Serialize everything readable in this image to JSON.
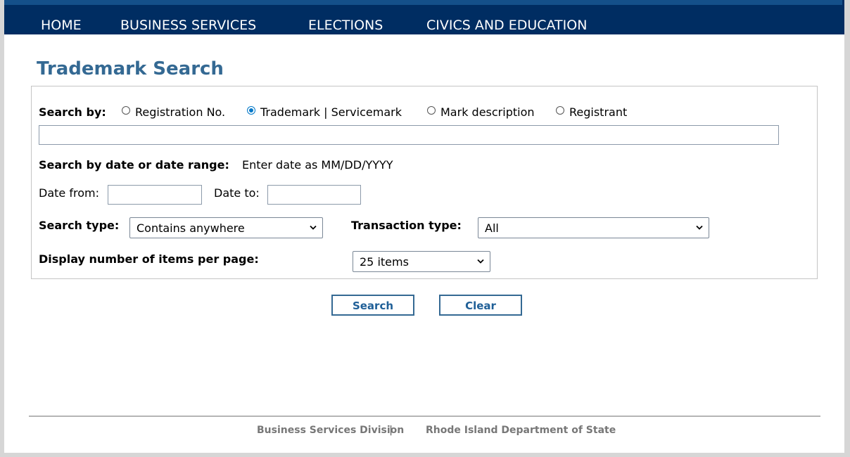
{
  "nav": {
    "items": [
      {
        "label": "HOME"
      },
      {
        "label": "BUSINESS SERVICES"
      },
      {
        "label": "ELECTIONS"
      },
      {
        "label": "CIVICS AND EDUCATION"
      }
    ]
  },
  "page": {
    "title": "Trademark Search"
  },
  "form": {
    "search_by_label": "Search by:",
    "search_by_options": [
      {
        "label": "Registration No.",
        "selected": false
      },
      {
        "label": "Trademark | Servicemark",
        "selected": true
      },
      {
        "label": "Mark description",
        "selected": false
      },
      {
        "label": "Registrant",
        "selected": false
      }
    ],
    "search_text_value": "",
    "date_range_label": "Search by date or date range:",
    "date_hint": "Enter date as MM/DD/YYYY",
    "date_from_label": "Date from:",
    "date_from_value": "",
    "date_to_label": "Date to:",
    "date_to_value": "",
    "search_type_label": "Search type:",
    "search_type_value": "Contains anywhere",
    "transaction_type_label": "Transaction type:",
    "transaction_type_value": "All",
    "items_per_page_label": "Display number of items per page:",
    "items_per_page_value": "25 items",
    "dropdown_icon": "chevron-down-icon",
    "radio_accent_color": "#0077c8"
  },
  "buttons": {
    "search_label": "Search",
    "clear_label": "Clear"
  },
  "footer": {
    "division": "Business Services Division",
    "separator": "|",
    "department": "Rhode Island Department of State"
  },
  "colors": {
    "nav_background": "#002d62",
    "title_color": "#346993",
    "button_border": "#346993"
  }
}
